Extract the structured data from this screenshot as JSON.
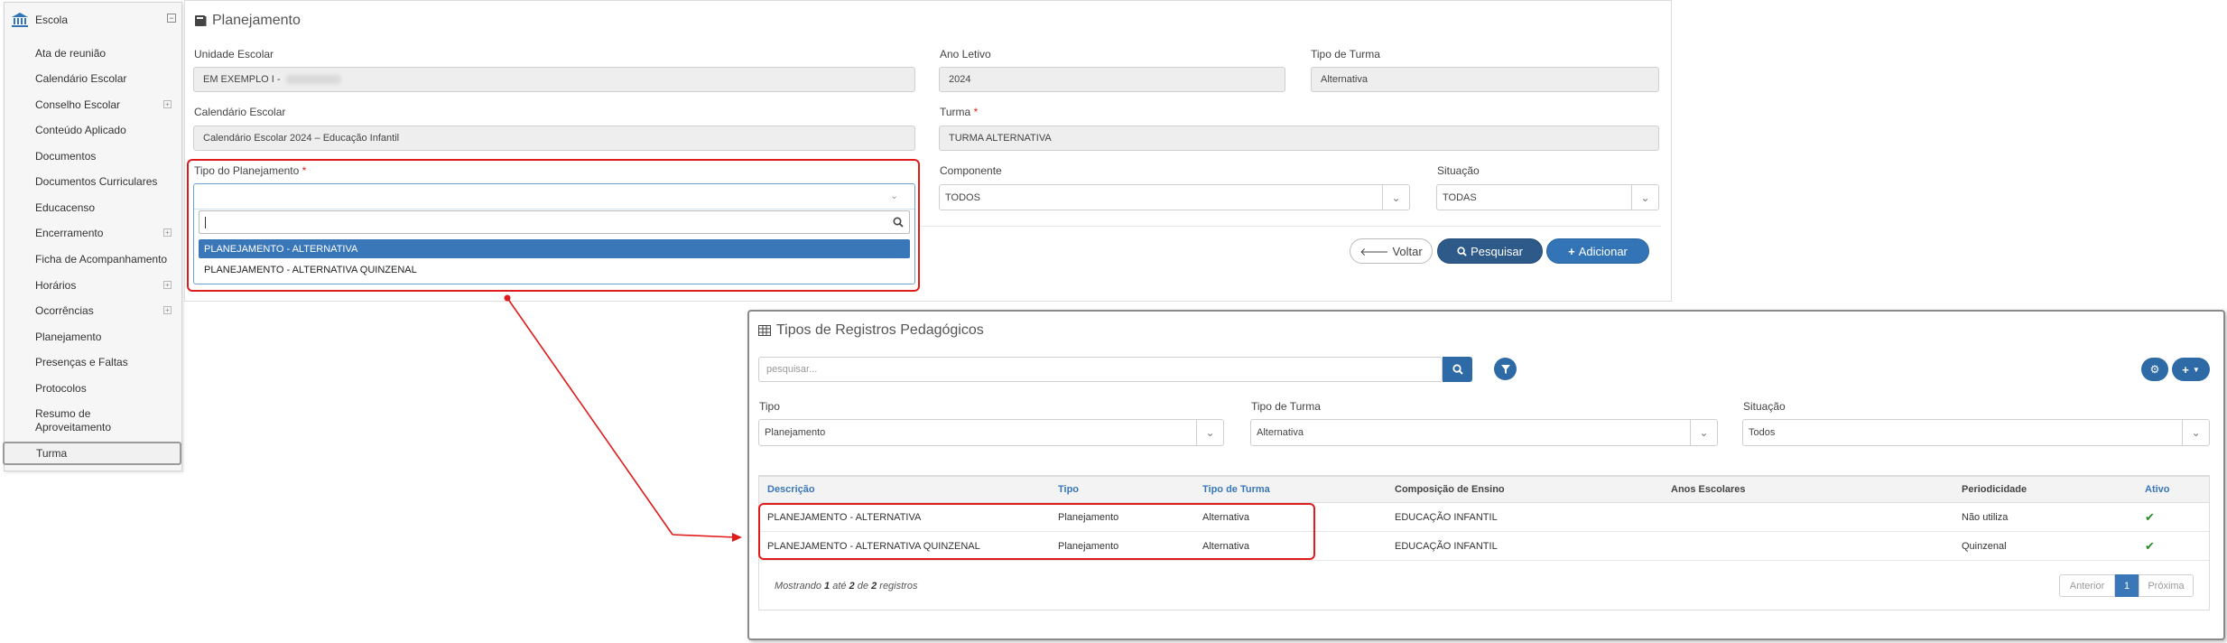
{
  "sidebar": {
    "header": "Escola",
    "items": [
      {
        "label": "Ata de reunião",
        "expandable": false
      },
      {
        "label": "Calendário Escolar",
        "expandable": false
      },
      {
        "label": "Conselho Escolar",
        "expandable": true
      },
      {
        "label": "Conteúdo Aplicado",
        "expandable": false
      },
      {
        "label": "Documentos",
        "expandable": false
      },
      {
        "label": "Documentos Curriculares",
        "expandable": false
      },
      {
        "label": "Educacenso",
        "expandable": false
      },
      {
        "label": "Encerramento",
        "expandable": true
      },
      {
        "label": "Ficha de Acompanhamento",
        "expandable": false
      },
      {
        "label": "Horários",
        "expandable": true
      },
      {
        "label": "Ocorrências",
        "expandable": true
      },
      {
        "label": "Planejamento",
        "expandable": false
      },
      {
        "label": "Presenças e Faltas",
        "expandable": false
      },
      {
        "label": "Protocolos",
        "expandable": false
      },
      {
        "label": "Resumo de Aproveitamento",
        "expandable": false
      },
      {
        "label": "Turma",
        "expandable": false,
        "active": true
      }
    ]
  },
  "planejamento": {
    "title": "Planejamento",
    "unidade_label": "Unidade Escolar",
    "unidade_value": "EM EXEMPLO I -",
    "ano_label": "Ano Letivo",
    "ano_value": "2024",
    "tipo_turma_label": "Tipo de Turma",
    "tipo_turma_value": "Alternativa",
    "calendario_label": "Calendário Escolar",
    "calendario_value": "Calendário Escolar 2024 – Educação Infantil",
    "turma_label": "Turma",
    "turma_value": "TURMA ALTERNATIVA",
    "tipo_plan_label": "Tipo do Planejamento",
    "componente_label": "Componente",
    "componente_value": "TODOS",
    "situacao_label": "Situação",
    "situacao_value": "TODAS",
    "required_mark": "*",
    "dropdown_options": [
      "PLANEJAMENTO - ALTERNATIVA",
      "PLANEJAMENTO - ALTERNATIVA QUINZENAL"
    ],
    "btn_voltar": "Voltar",
    "btn_pesquisar": "Pesquisar",
    "btn_adicionar": "Adicionar"
  },
  "tipos": {
    "title": "Tipos de Registros Pedagógicos",
    "search_placeholder": "pesquisar...",
    "filtro_tipo_label": "Tipo",
    "filtro_tipo_value": "Planejamento",
    "filtro_turma_label": "Tipo de Turma",
    "filtro_turma_value": "Alternativa",
    "filtro_situacao_label": "Situação",
    "filtro_situacao_value": "Todos",
    "columns": [
      "Descrição",
      "Tipo",
      "Tipo de Turma",
      "Composição de Ensino",
      "Anos Escolares",
      "Periodicidade",
      "Ativo"
    ],
    "rows": [
      {
        "descricao": "PLANEJAMENTO - ALTERNATIVA",
        "tipo": "Planejamento",
        "tipo_turma": "Alternativa",
        "composicao": "EDUCAÇÃO INFANTIL",
        "anos": "",
        "periodicidade": "Não utiliza",
        "ativo": "✔"
      },
      {
        "descricao": "PLANEJAMENTO - ALTERNATIVA QUINZENAL",
        "tipo": "Planejamento",
        "tipo_turma": "Alternativa",
        "composicao": "EDUCAÇÃO INFANTIL",
        "anos": "",
        "periodicidade": "Quinzenal",
        "ativo": "✔"
      }
    ],
    "footer": {
      "prefix": "Mostrando",
      "from": "1",
      "mid1": "até",
      "to": "2",
      "mid2": "de",
      "total": "2",
      "suffix": "registros"
    },
    "pager": {
      "prev": "Anterior",
      "current": "1",
      "next": "Próxima"
    }
  },
  "colors": {
    "accent": "#3274b5",
    "dark_accent": "#2e5a8a",
    "highlight": "#e01b1b",
    "check": "#2b8a2b"
  }
}
